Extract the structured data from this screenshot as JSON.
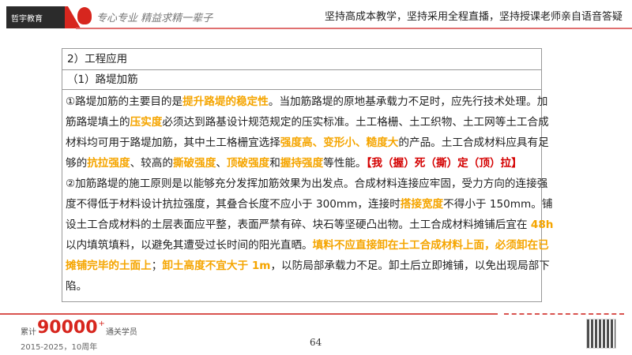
{
  "header": {
    "logo_text": "哲宇教育",
    "slogan_script": "专心专业 精益求精一辈子",
    "tagline": "坚持高成本教学，坚持采用全程直播，坚持授课老师亲自语音答疑"
  },
  "table": {
    "heading": "2）工程应用",
    "subheading": "（1）路堤加筋",
    "lines": [
      [
        {
          "t": "①路堤加筋的主要目的是"
        },
        {
          "t": "提升路堤的稳定性",
          "s": "hl"
        },
        {
          "t": "。当加筋路堤的原地基承载力不足时，应先行技术处理。加"
        }
      ],
      [
        {
          "t": "筋路堤填土的"
        },
        {
          "t": "压实度",
          "s": "hl"
        },
        {
          "t": "必须达到路基设计规范规定的压实标准。土工格栅、土工织物、土工网等土工合成"
        }
      ],
      [
        {
          "t": "材料均可用于路堤加筋，其中土工格栅宜选择"
        },
        {
          "t": "强度高、变形小、糙度大",
          "s": "hl"
        },
        {
          "t": "的产品。土工合成材料应具有足"
        }
      ],
      [
        {
          "t": "够的"
        },
        {
          "t": "抗拉强度",
          "s": "hl"
        },
        {
          "t": "、较高的"
        },
        {
          "t": "撕破强度",
          "s": "hl"
        },
        {
          "t": "、"
        },
        {
          "t": "顶破强度",
          "s": "hl"
        },
        {
          "t": "和"
        },
        {
          "t": "握持强度",
          "s": "hl"
        },
        {
          "t": "等性能。"
        },
        {
          "t": "【我（握）死（撕）定（顶）拉】",
          "s": "red"
        }
      ],
      [
        {
          "t": "②加筋路堤的施工原则是以能够充分发挥加筋效果为出发点。合成材料连接应牢固，受力方向的连接强"
        }
      ],
      [
        {
          "t": "度不得低于材料设计抗拉强度，其叠合长度不应小于 300mm，连接时"
        },
        {
          "t": "搭接宽度",
          "s": "hl"
        },
        {
          "t": "不得小于 150mm。铺"
        }
      ],
      [
        {
          "t": "设土工合成材料的土层表面应平整，表面严禁有碎、块石等坚硬凸出物。土工合成材料摊铺后宜在 "
        },
        {
          "t": "48h",
          "s": "hl"
        }
      ],
      [
        {
          "t": "以内填筑填料，以避免其遭受过长时间的阳光直晒。"
        },
        {
          "t": "填料不应直接卸在土工合成材料上面，必须卸在已",
          "s": "hl"
        }
      ],
      [
        {
          "t": "摊铺完毕的土面上",
          "s": "hl"
        },
        {
          "t": "；"
        },
        {
          "t": "卸土高度不宜大于 1m",
          "s": "hl"
        },
        {
          "t": "，以防局部承载力不足。卸土后立即摊铺，以免出现局部下"
        }
      ],
      [
        {
          "t": "陷。"
        }
      ]
    ]
  },
  "footer": {
    "stat_prefix": "累计",
    "stat_number": "90000",
    "stat_plus": "+",
    "stat_suffix": "通关学员",
    "years": "2015-2025，10周年",
    "page_number": "64"
  },
  "colors": {
    "highlight": "#f5a500",
    "mnemonic": "#d40000",
    "brand": "#d7261e"
  }
}
